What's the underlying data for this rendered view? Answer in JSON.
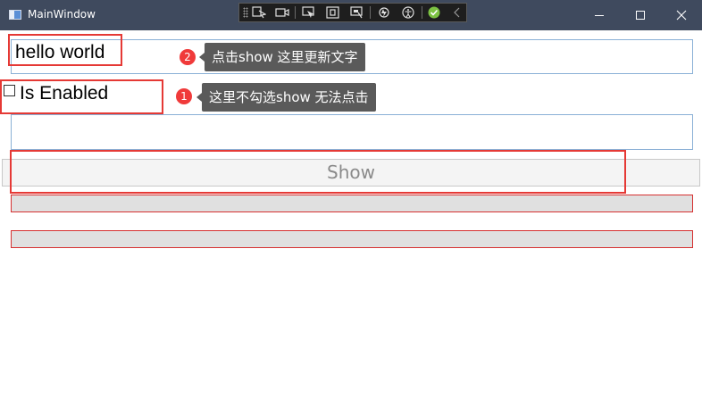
{
  "window": {
    "title": "MainWindow"
  },
  "toolbar": {
    "icons": [
      "select-element-icon",
      "record-icon",
      "selection-icon",
      "layout-adorner-icon",
      "track-focus-icon",
      "hot-reload-icon",
      "accessibility-icon",
      "binding-check-icon",
      "collapse-icon"
    ]
  },
  "main": {
    "text_input_value": "hello world",
    "checkbox_label": "Is Enabled",
    "checkbox_checked": false,
    "second_input_value": "",
    "show_button_label": "Show"
  },
  "annotations": [
    {
      "number": "2",
      "text": "点击show 这里更新文字"
    },
    {
      "number": "1",
      "text": "这里不勾选show 无法点击"
    }
  ],
  "progress_bars": [
    {
      "value": 0
    },
    {
      "value": 0
    }
  ],
  "colors": {
    "titlebar": "#3f4a5e",
    "highlight": "#e53935",
    "badge": "#f03a3a",
    "callout": "#5a5a5a",
    "input_border": "#8ab0d6",
    "progress_border": "#d63030"
  }
}
